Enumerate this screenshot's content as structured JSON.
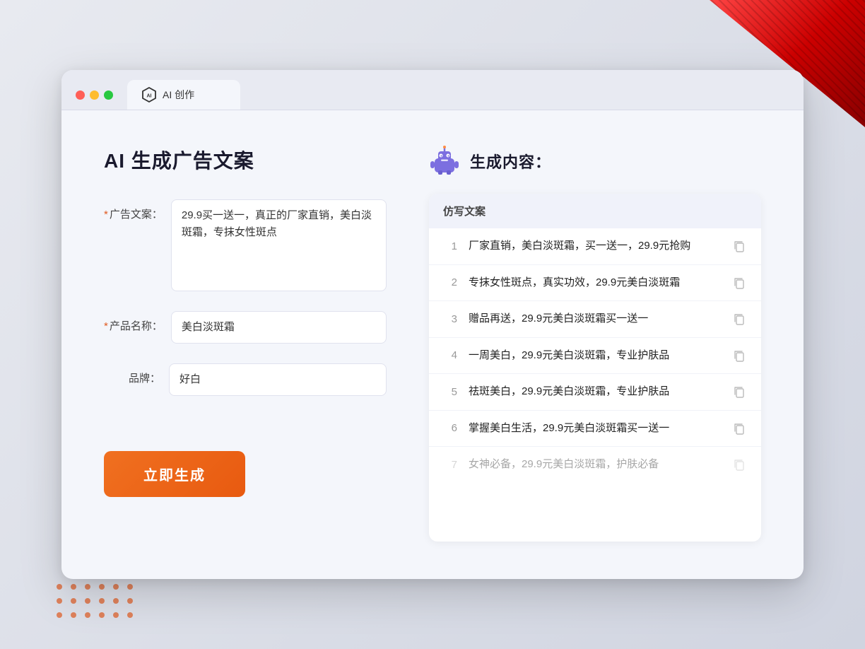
{
  "window": {
    "tab_title": "AI 创作"
  },
  "page": {
    "title": "AI 生成广告文案",
    "form": {
      "ad_copy_label": "广告文案：",
      "ad_copy_required": "*",
      "ad_copy_value": "29.9买一送一，真正的厂家直销，美白淡斑霜，专抹女性斑点",
      "product_name_label": "产品名称：",
      "product_name_required": "*",
      "product_name_value": "美白淡斑霜",
      "brand_label": "品牌：",
      "brand_value": "好白",
      "generate_button": "立即生成"
    },
    "result": {
      "header_title": "生成内容：",
      "table_header": "仿写文案",
      "rows": [
        {
          "num": "1",
          "text": "厂家直销，美白淡斑霜，买一送一，29.9元抢购",
          "dimmed": false
        },
        {
          "num": "2",
          "text": "专抹女性斑点，真实功效，29.9元美白淡斑霜",
          "dimmed": false
        },
        {
          "num": "3",
          "text": "赠品再送，29.9元美白淡斑霜买一送一",
          "dimmed": false
        },
        {
          "num": "4",
          "text": "一周美白，29.9元美白淡斑霜，专业护肤品",
          "dimmed": false
        },
        {
          "num": "5",
          "text": "祛斑美白，29.9元美白淡斑霜，专业护肤品",
          "dimmed": false
        },
        {
          "num": "6",
          "text": "掌握美白生活，29.9元美白淡斑霜买一送一",
          "dimmed": false
        },
        {
          "num": "7",
          "text": "女神必备，29.9元美白淡斑霜，护肤必备",
          "dimmed": true
        }
      ]
    }
  }
}
